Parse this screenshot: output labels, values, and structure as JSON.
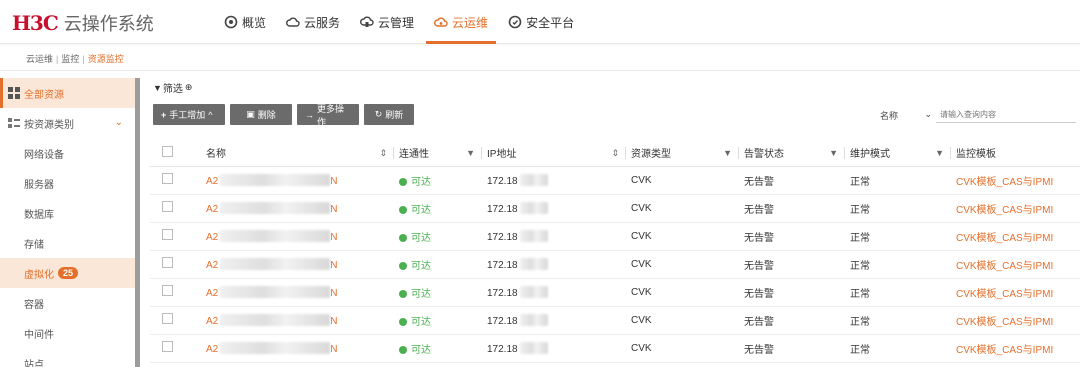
{
  "brand": {
    "mark": "H3C",
    "title": "云操作系统"
  },
  "nav": [
    {
      "label": "概览",
      "icon": "overview-icon",
      "active": false
    },
    {
      "label": "云服务",
      "icon": "cloud-service-icon",
      "active": false
    },
    {
      "label": "云管理",
      "icon": "cloud-manage-icon",
      "active": false
    },
    {
      "label": "云运维",
      "icon": "cloud-ops-icon",
      "active": true
    },
    {
      "label": "安全平台",
      "icon": "security-icon",
      "active": false
    }
  ],
  "breadcrumb": [
    "云运维",
    "监控",
    "资源监控"
  ],
  "sidebar": {
    "all_label": "全部资源",
    "by_type_label": "按资源类别",
    "items": [
      {
        "label": "网络设备"
      },
      {
        "label": "服务器"
      },
      {
        "label": "数据库"
      },
      {
        "label": "存储"
      },
      {
        "label": "虚拟化",
        "badge": "25",
        "active": true
      },
      {
        "label": "容器"
      },
      {
        "label": "中间件"
      },
      {
        "label": "站点"
      }
    ]
  },
  "filter_label": "筛选",
  "toolbar": {
    "add_label": "手工增加",
    "delete_label": "删除",
    "more_label": "更多操作",
    "refresh_label": "刷新"
  },
  "search": {
    "field": "名称",
    "placeholder": "请输入查询内容"
  },
  "table": {
    "columns": [
      "名称",
      "连通性",
      "IP地址",
      "资源类型",
      "告警状态",
      "维护模式",
      "监控模板"
    ],
    "rows": [
      {
        "name": "A2",
        "name_tail": "N",
        "conn": "可达",
        "ip": "172.18",
        "type": "CVK",
        "alarm": "无告警",
        "maint": "正常",
        "template": "CVK模板_CAS与IPMI"
      },
      {
        "name": "A2",
        "name_tail": "N",
        "conn": "可达",
        "ip": "172.18",
        "type": "CVK",
        "alarm": "无告警",
        "maint": "正常",
        "template": "CVK模板_CAS与IPMI"
      },
      {
        "name": "A2",
        "name_tail": "N",
        "conn": "可达",
        "ip": "172.18",
        "type": "CVK",
        "alarm": "无告警",
        "maint": "正常",
        "template": "CVK模板_CAS与IPMI"
      },
      {
        "name": "A2",
        "name_tail": "N",
        "conn": "可达",
        "ip": "172.18",
        "type": "CVK",
        "alarm": "无告警",
        "maint": "正常",
        "template": "CVK模板_CAS与IPMI"
      },
      {
        "name": "A2",
        "name_tail": "N",
        "conn": "可达",
        "ip": "172.18",
        "type": "CVK",
        "alarm": "无告警",
        "maint": "正常",
        "template": "CVK模板_CAS与IPMI"
      },
      {
        "name": "A2",
        "name_tail": "N",
        "conn": "可达",
        "ip": "172.18",
        "type": "CVK",
        "alarm": "无告警",
        "maint": "正常",
        "template": "CVK模板_CAS与IPMI"
      },
      {
        "name": "A2",
        "name_tail": "N",
        "conn": "可达",
        "ip": "172.18",
        "type": "CVK",
        "alarm": "无告警",
        "maint": "正常",
        "template": "CVK模板_CAS与IPMI"
      }
    ]
  },
  "colors": {
    "accent": "#e36f2a",
    "ok": "#4caf50",
    "brand_red": "#c8102e",
    "button": "#6b6b6b"
  }
}
